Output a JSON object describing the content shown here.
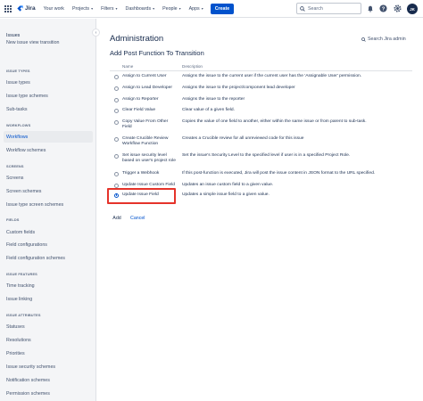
{
  "topnav": {
    "logo_text": "Jira",
    "items": [
      {
        "label": "Your work",
        "has_dropdown": false
      },
      {
        "label": "Projects",
        "has_dropdown": true
      },
      {
        "label": "Filters",
        "has_dropdown": true
      },
      {
        "label": "Dashboards",
        "has_dropdown": true
      },
      {
        "label": "People",
        "has_dropdown": true
      },
      {
        "label": "Apps",
        "has_dropdown": true
      }
    ],
    "create_label": "Create",
    "search_placeholder": "Search",
    "avatar_initials": "JK",
    "icons": [
      "apps-grid-icon",
      "notifications-icon",
      "help-icon",
      "settings-icon"
    ]
  },
  "sidebar": {
    "title": "Issues",
    "items": [
      {
        "type": "item",
        "label": "New issue view transition"
      },
      {
        "type": "section",
        "label": "ISSUE TYPES"
      },
      {
        "type": "item",
        "label": "Issue types"
      },
      {
        "type": "item",
        "label": "Issue type schemes"
      },
      {
        "type": "item",
        "label": "Sub-tasks"
      },
      {
        "type": "section",
        "label": "WORKFLOWS"
      },
      {
        "type": "item",
        "label": "Workflows",
        "active": true
      },
      {
        "type": "item",
        "label": "Workflow schemes"
      },
      {
        "type": "section",
        "label": "SCREENS"
      },
      {
        "type": "item",
        "label": "Screens"
      },
      {
        "type": "item",
        "label": "Screen schemes"
      },
      {
        "type": "item",
        "label": "Issue type screen schemes"
      },
      {
        "type": "section",
        "label": "FIELDS"
      },
      {
        "type": "item",
        "label": "Custom fields"
      },
      {
        "type": "item",
        "label": "Field configurations"
      },
      {
        "type": "item",
        "label": "Field configuration schemes"
      },
      {
        "type": "section",
        "label": "ISSUE FEATURES"
      },
      {
        "type": "item",
        "label": "Time tracking"
      },
      {
        "type": "item",
        "label": "Issue linking"
      },
      {
        "type": "section",
        "label": "ISSUE ATTRIBUTES"
      },
      {
        "type": "item",
        "label": "Statuses"
      },
      {
        "type": "item",
        "label": "Resolutions"
      },
      {
        "type": "item",
        "label": "Priorities"
      },
      {
        "type": "item",
        "label": "Issue security schemes"
      },
      {
        "type": "item",
        "label": "Notification schemes"
      },
      {
        "type": "item",
        "label": "Permission schemes"
      }
    ]
  },
  "main": {
    "title": "Administration",
    "search_admin_label": "Search Jira admin",
    "subtitle": "Add Post Function To Transition",
    "columns": {
      "name": "Name",
      "description": "Description"
    },
    "rows": [
      {
        "name": "Assign to Current User",
        "description": "Assigns the issue to the current user if the current user has the 'Assignable User' permission.",
        "checked": false
      },
      {
        "name": "Assign to Lead Developer",
        "description": "Assigns the issue to the project/component lead developer",
        "checked": false
      },
      {
        "name": "Assign to Reporter",
        "description": "Assigns the issue to the reporter",
        "checked": false
      },
      {
        "name": "Clear Field Value",
        "description": "Clear value of a given field.",
        "checked": false
      },
      {
        "name": "Copy Value From Other Field",
        "description": "Copies the value of one field to another, either within the same issue or from parent to sub-task.",
        "checked": false
      },
      {
        "name": "Create Crucible Review Workflow Function",
        "description": "Creates a Crucible review for all unreviewed code for this issue",
        "checked": false
      },
      {
        "name": "Set issue security level based on user's project role",
        "description": "Set the issue's Security Level to the specified level if user is in a specified Project Role.",
        "checked": false
      },
      {
        "name": "Trigger a Webhook",
        "description": "If this post-function is executed, Jira will post the issue content in JSON format to the URL specified.",
        "checked": false
      },
      {
        "name": "Update Issue Custom Field",
        "description": "Updates an issue custom field to a given value.",
        "checked": false
      },
      {
        "name": "Update Issue Field",
        "description": "Updates a simple issue field to a given value.",
        "checked": true
      }
    ],
    "add_label": "Add",
    "cancel_label": "Cancel"
  },
  "colors": {
    "brand": "#0052cc",
    "highlight": "#e5332a",
    "sidebar_bg": "#f4f5f7",
    "text": "#172b4d"
  }
}
